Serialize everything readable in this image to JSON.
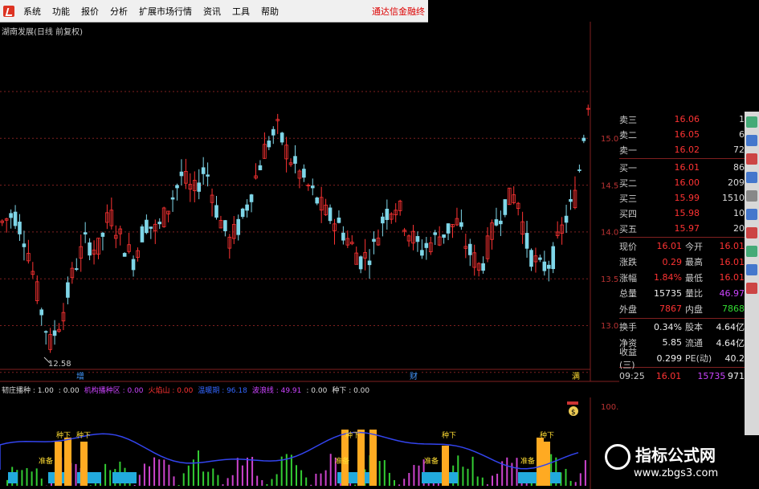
{
  "menu": {
    "items": [
      "系统",
      "功能",
      "报价",
      "分析",
      "扩展市场行情",
      "资讯",
      "工具",
      "帮助"
    ],
    "promo": "通达信金融终"
  },
  "stock_title": "湖南发展(日线 前复权)",
  "price_axis": [
    "15.00",
    "14.50",
    "14.00",
    "13.50",
    "13.00"
  ],
  "low_marker": "12.58",
  "chart_markers": [
    "增",
    "财",
    "满"
  ],
  "indicator": {
    "items": [
      {
        "text": "韧庄播种 : 1.00",
        "color": "#dddddd"
      },
      {
        "text": ": 0.00",
        "color": "#dddddd"
      },
      {
        "text": "机构播种区 : 0.00",
        "color": "#cc44ff"
      },
      {
        "text": "火焰山 : 0.00",
        "color": "#ff3333"
      },
      {
        "text": "温暖期 : 96.18",
        "color": "#3366ff"
      },
      {
        "text": "波浪线 : 49.91",
        "color": "#cc44ff"
      },
      {
        "text": ": 0.00",
        "color": "#dddddd"
      },
      {
        "text": "种下 : 0.00",
        "color": "#dddddd"
      }
    ],
    "axis_value": "100.0",
    "badge": "$",
    "zhongxia": "种下",
    "zhunbei": "准备"
  },
  "colors": {
    "up": "#ff3333",
    "down": "#7fd6e8",
    "grid": "#802020",
    "wave": "#3344ee",
    "bar_green": "#33cc33",
    "bar_orange": "#ffaa22",
    "bar_cyan": "#22aadd"
  },
  "quote": {
    "sell": [
      {
        "label": "卖三",
        "price": "16.06",
        "vol": "1"
      },
      {
        "label": "卖二",
        "price": "16.05",
        "vol": "6"
      },
      {
        "label": "卖一",
        "price": "16.02",
        "vol": "72"
      }
    ],
    "buy": [
      {
        "label": "买一",
        "price": "16.01",
        "vol": "86"
      },
      {
        "label": "买二",
        "price": "16.00",
        "vol": "209"
      },
      {
        "label": "买三",
        "price": "15.99",
        "vol": "1510"
      },
      {
        "label": "买四",
        "price": "15.98",
        "vol": "10"
      },
      {
        "label": "买五",
        "price": "15.97",
        "vol": "20"
      }
    ],
    "stats": [
      {
        "a": "现价",
        "b": "16.01",
        "bc": "red",
        "c": "今开",
        "d": "16.01",
        "dc": "red"
      },
      {
        "a": "涨跌",
        "b": "0.29",
        "bc": "red",
        "c": "最高",
        "d": "16.01",
        "dc": "red"
      },
      {
        "a": "涨幅",
        "b": "1.84%",
        "bc": "red",
        "c": "最低",
        "d": "16.01",
        "dc": "red"
      },
      {
        "a": "总量",
        "b": "15735",
        "bc": "white",
        "c": "量比",
        "d": "46.97",
        "dc": "purple"
      },
      {
        "a": "外盘",
        "b": "7867",
        "bc": "red",
        "c": "内盘",
        "d": "7868",
        "dc": "green"
      }
    ],
    "stats2": [
      {
        "a": "换手",
        "b": "0.34%",
        "bc": "white",
        "c": "股本",
        "d": "4.64亿",
        "dc": "white"
      },
      {
        "a": "净资",
        "b": "5.85",
        "bc": "white",
        "c": "流通",
        "d": "4.64亿",
        "dc": "white"
      },
      {
        "a": "收益(三)",
        "b": "0.299",
        "bc": "white",
        "c": "PE(动)",
        "d": "40.2",
        "dc": "white"
      }
    ],
    "tick": {
      "time": "09:25",
      "price": "16.01",
      "vol": "15735",
      "num": "971"
    }
  },
  "watermark": {
    "title": "指标公式网",
    "url": "www.zbgs3.com"
  }
}
